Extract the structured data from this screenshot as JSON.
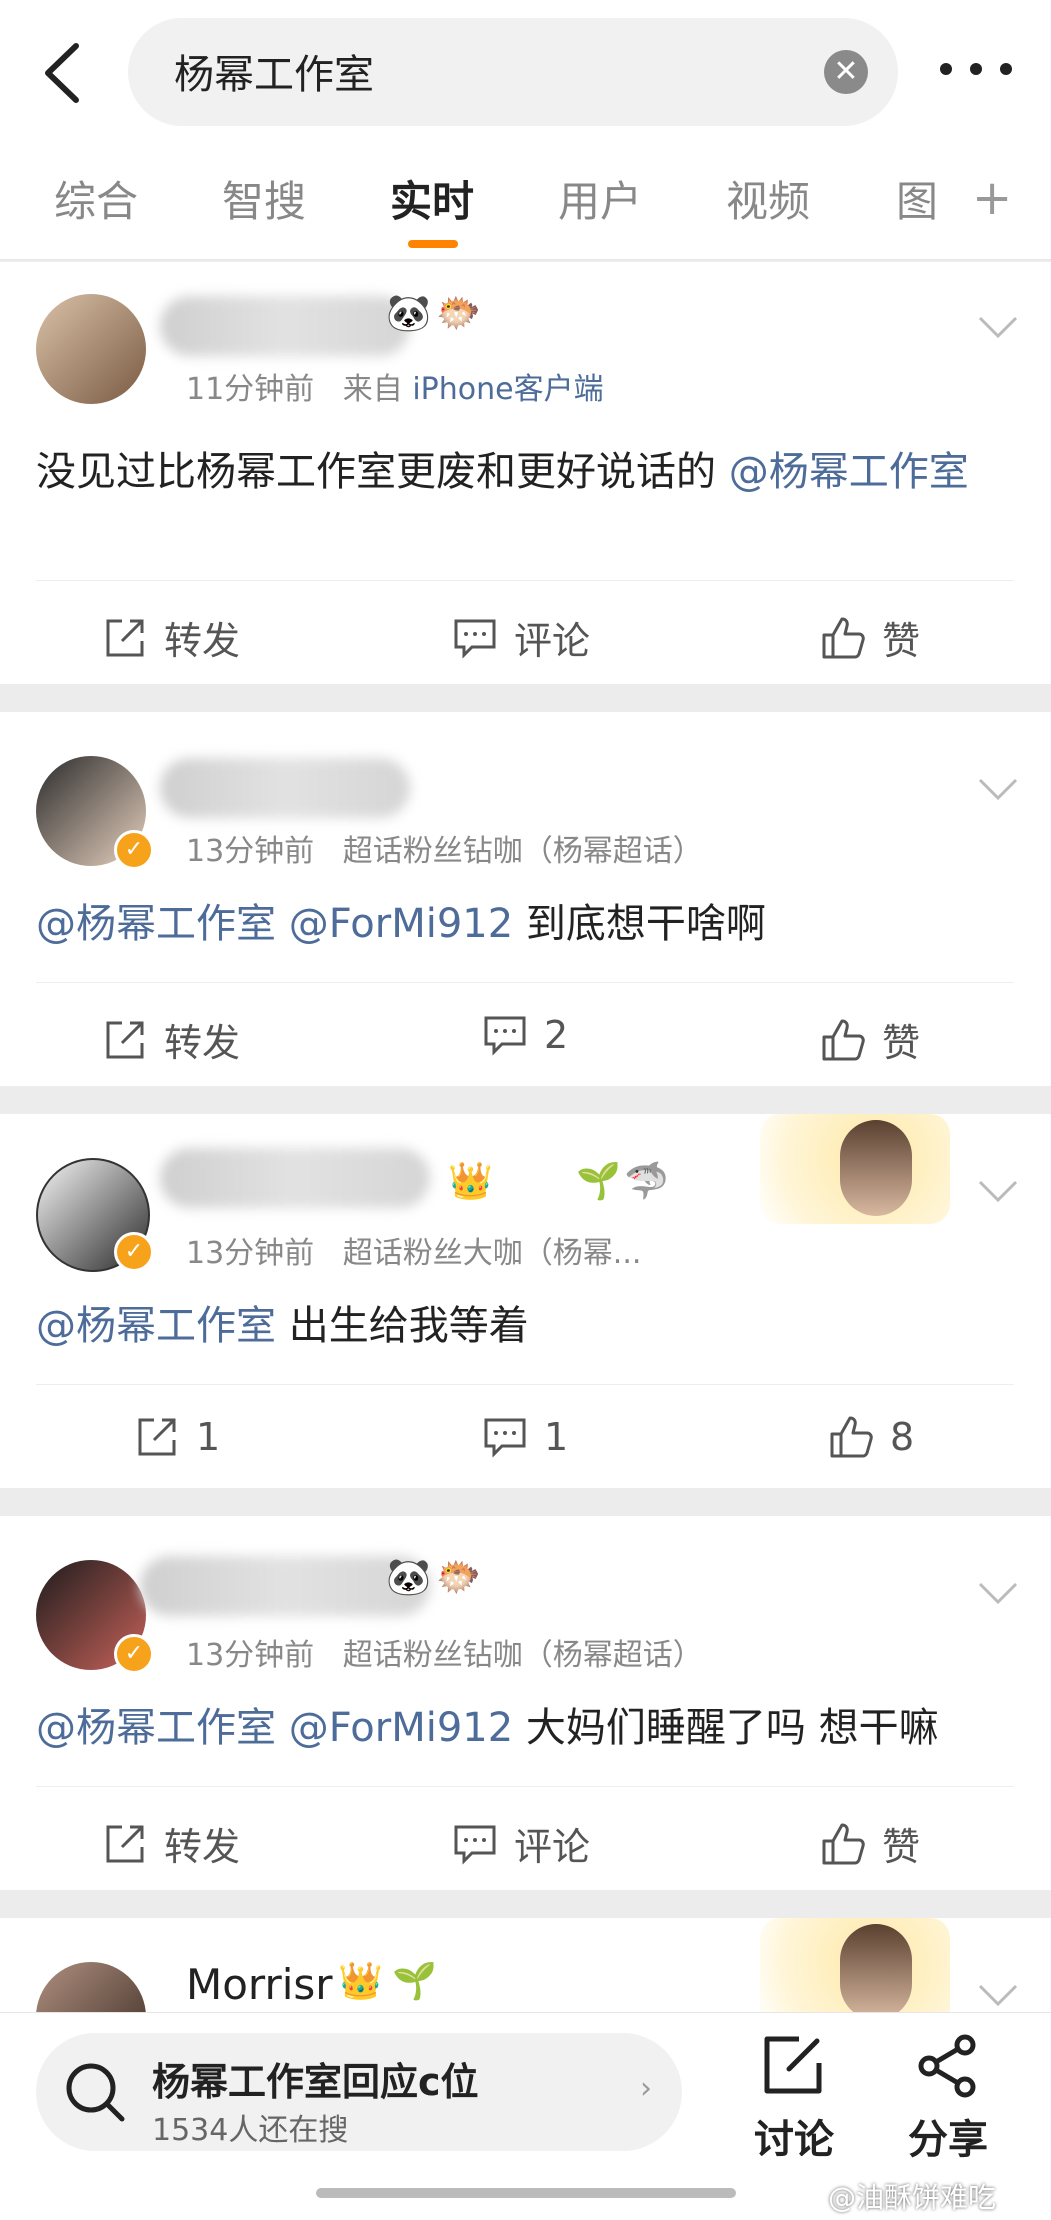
{
  "search": {
    "query": "杨幂工作室"
  },
  "tabs": [
    {
      "label": "综合"
    },
    {
      "label": "智搜"
    },
    {
      "label": "实时"
    },
    {
      "label": "用户"
    },
    {
      "label": "视频"
    },
    {
      "label": "图"
    }
  ],
  "posts": [
    {
      "time": "11分钟前",
      "source_prefix": "来自",
      "source": "iPhone客户端",
      "content_text": "没见过比杨幂工作室更废和更好说话的",
      "mention1": "@杨幂工作室",
      "repost": "转发",
      "comment": "评论",
      "like": "赞"
    },
    {
      "time": "13分钟前",
      "source": "超话粉丝钻咖（杨幂超话）",
      "mention1": "@杨幂工作室",
      "mention2": "@ForMi912",
      "content_text": "到底想干啥啊",
      "repost": "转发",
      "comment": "2",
      "like": "赞"
    },
    {
      "time": "13分钟前",
      "source": "超话粉丝大咖（杨幂...",
      "mention1": "@杨幂工作室",
      "content_text": "出生给我等着",
      "repost": "1",
      "comment": "1",
      "like": "8"
    },
    {
      "time": "13分钟前",
      "source": "超话粉丝钻咖（杨幂超话）",
      "mention1": "@杨幂工作室",
      "mention2": "@ForMi912",
      "content_text": "大妈们睡醒了吗 想干嘛",
      "repost": "转发",
      "comment": "评论",
      "like": "赞"
    },
    {
      "username": "Morrisr"
    }
  ],
  "bottom": {
    "hot_title": "杨幂工作室回应c位",
    "hot_sub": "1534人还在搜",
    "discuss": "讨论",
    "share": "分享"
  },
  "watermark": "@油酥饼难吃",
  "colors": {
    "accent": "#ff8200",
    "link": "#4d6c9a",
    "verified": "#f7a21b"
  }
}
